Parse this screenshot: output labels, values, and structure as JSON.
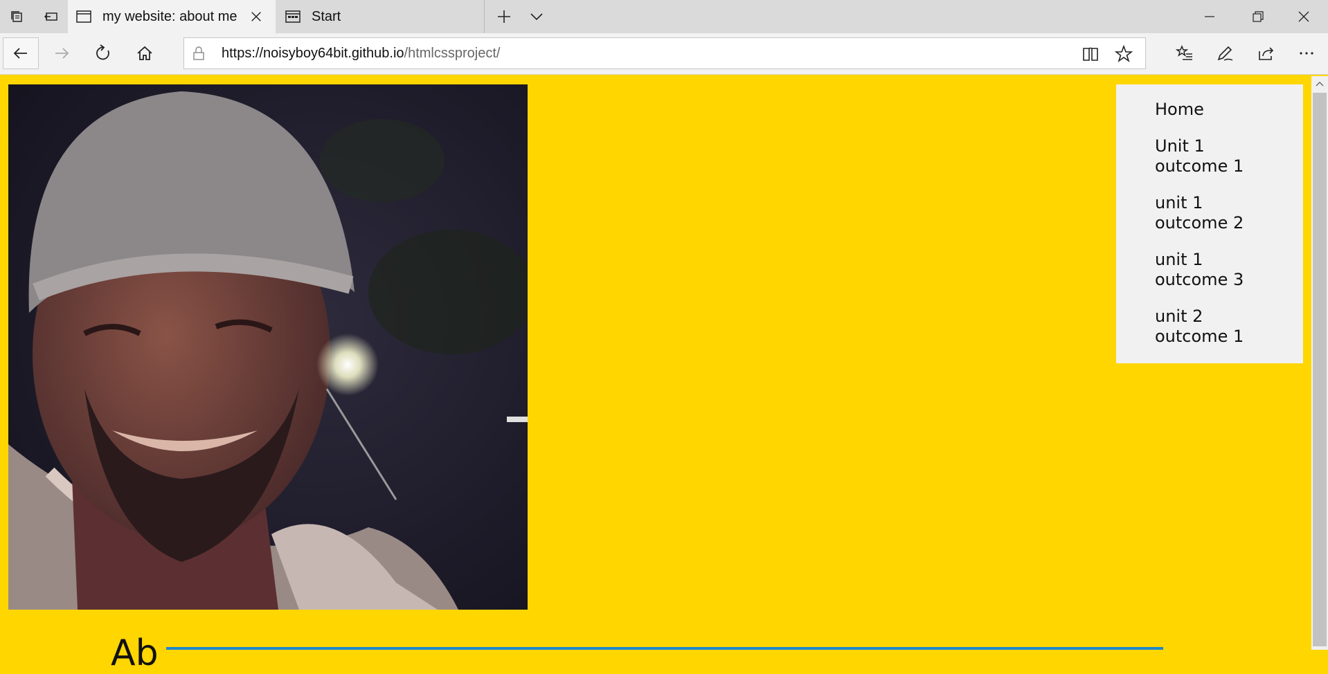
{
  "browser": {
    "tabs": [
      {
        "title": "my website: about me",
        "active": true
      },
      {
        "title": "Start",
        "active": false
      }
    ],
    "address": {
      "url_host": "https://noisyboy64bit.github.io",
      "url_path": "/htmlcssproject/"
    }
  },
  "sidenav": {
    "links": [
      {
        "label": "Home"
      },
      {
        "label": "Unit 1 outcome 1"
      },
      {
        "label": "unit 1 outcome 2"
      },
      {
        "label": "unit 1 outcome 3"
      },
      {
        "label": "unit 2 outcome 1"
      }
    ]
  },
  "page": {
    "heading": "Ab",
    "background": "#ffd600",
    "accent": "#1e88c9"
  },
  "icons": [
    "tab-actions-icon",
    "set-aside-tabs-icon",
    "page-icon",
    "close-icon",
    "start-page-icon",
    "new-tab-icon",
    "tab-preview-icon",
    "minimize-icon",
    "restore-icon",
    "window-close-icon",
    "back-icon",
    "forward-icon",
    "refresh-icon",
    "home-icon",
    "lock-icon",
    "reading-view-icon",
    "favorite-star-icon",
    "favorites-hub-icon",
    "web-note-icon",
    "share-icon",
    "more-icon"
  ]
}
